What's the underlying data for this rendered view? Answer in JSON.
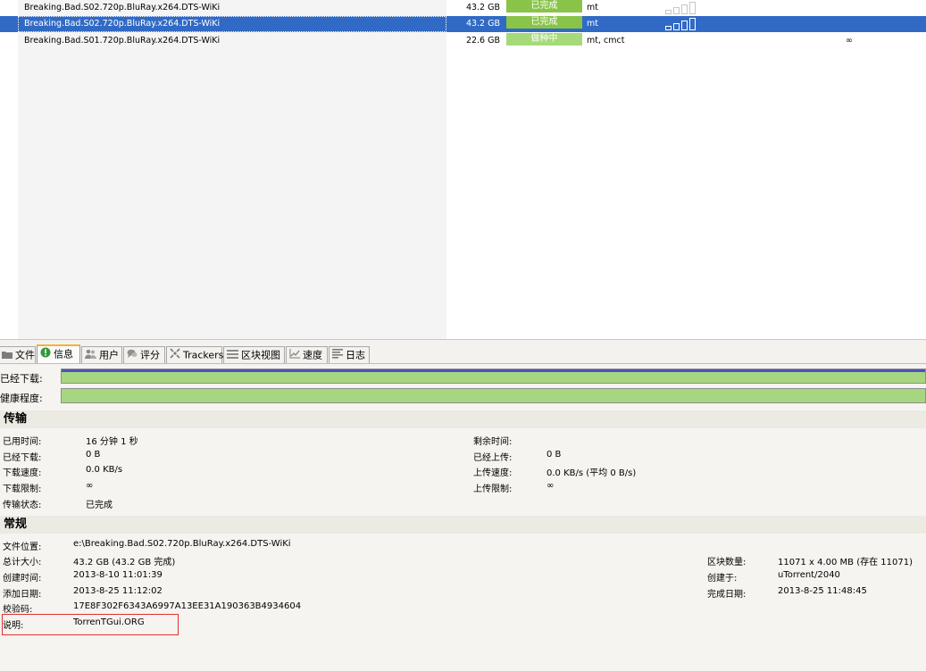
{
  "torrents": [
    {
      "name": "Breaking.Bad.S02.720p.BluRay.x264.DTS-WiKi",
      "size": "43.2 GB",
      "status": "已完成",
      "label": "mt",
      "availability": ""
    },
    {
      "name": "Breaking.Bad.S02.720p.BluRay.x264.DTS-WiKi",
      "size": "43.2 GB",
      "status": "已完成",
      "label": "mt",
      "availability": ""
    },
    {
      "name": "Breaking.Bad.S01.720p.BluRay.x264.DTS-WiKi",
      "size": "22.6 GB",
      "status": "做种中",
      "label": "mt, cmct",
      "availability": "∞"
    }
  ],
  "tabs": [
    {
      "label": "文件",
      "icon": "folder-icon"
    },
    {
      "label": "信息",
      "icon": "info-icon"
    },
    {
      "label": "用户",
      "icon": "users-icon"
    },
    {
      "label": "评分",
      "icon": "ratings-icon"
    },
    {
      "label": "Trackers",
      "icon": "trackers-icon"
    },
    {
      "label": "区块视图",
      "icon": "pieces-icon"
    },
    {
      "label": "速度",
      "icon": "speed-chart-icon"
    },
    {
      "label": "日志",
      "icon": "log-icon"
    }
  ],
  "progress": {
    "downloaded_label": "已经下载:",
    "downloaded_fraction": 1.0,
    "health_label": "健康程度:",
    "health_fraction": 1.0
  },
  "transfer": {
    "title": "传输",
    "left": [
      {
        "key": "已用时间:",
        "value": "16 分钟 1 秒"
      },
      {
        "key": "已经下载:",
        "value": "0 B"
      },
      {
        "key": "下载速度:",
        "value": "0.0 KB/s"
      },
      {
        "key": "下载限制:",
        "value": "∞"
      },
      {
        "key": "传输状态:",
        "value": "已完成"
      }
    ],
    "right": [
      {
        "key": "剩余时间:",
        "value": ""
      },
      {
        "key": "已经上传:",
        "value": "0 B"
      },
      {
        "key": "上传速度:",
        "value": "0.0 KB/s (平均 0 B/s)"
      },
      {
        "key": "上传限制:",
        "value": "∞"
      }
    ]
  },
  "general": {
    "title": "常规",
    "left": [
      {
        "key": "文件位置:",
        "value": "e:\\Breaking.Bad.S02.720p.BluRay.x264.DTS-WiKi"
      },
      {
        "key": "总计大小:",
        "value": "43.2 GB (43.2 GB 完成)"
      },
      {
        "key": "创建时间:",
        "value": "2013-8-10 11:01:39"
      },
      {
        "key": "添加日期:",
        "value": "2013-8-25 11:12:02"
      },
      {
        "key": "校验码:",
        "value": "17E8F302F6343A6997A13EE31A190363B4934604"
      },
      {
        "key": "说明:",
        "value": "TorrenTGui.ORG"
      }
    ],
    "right": [
      {
        "key": "区块数量:",
        "value": "11071 x 4.00 MB (存在 11071)"
      },
      {
        "key": "创建于:",
        "value": "uTorrent/2040"
      },
      {
        "key": "完成日期:",
        "value": "2013-8-25 11:48:45"
      }
    ]
  },
  "colors": {
    "status_done": "#89c449",
    "status_seeding": "#a6d97a",
    "selection": "#316ac5",
    "progress_fill": "#a6d780",
    "annotation_box": "#e03030"
  }
}
